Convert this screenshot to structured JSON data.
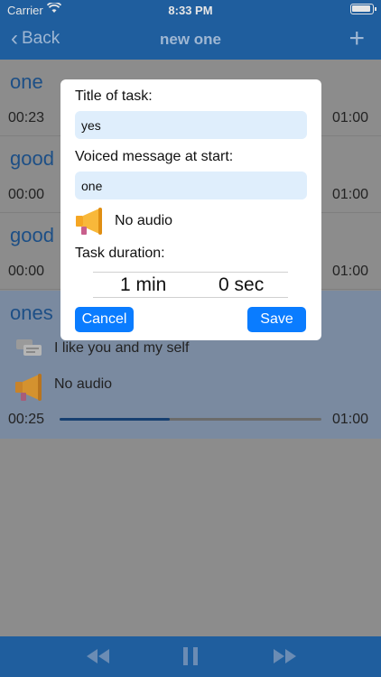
{
  "status_bar": {
    "carrier": "Carrier",
    "time": "8:33 PM"
  },
  "nav": {
    "back_label": "Back",
    "title": "new one",
    "add_icon": "plus-icon"
  },
  "tasks": [
    {
      "name": "one",
      "elapsed": "00:23",
      "duration": "01:00"
    },
    {
      "name": "good",
      "elapsed": "00:00",
      "duration": "01:00"
    },
    {
      "name": "good",
      "elapsed": "00:00",
      "duration": "01:00"
    }
  ],
  "active_task": {
    "name": "ones",
    "message": "I like you and my self",
    "audio": "No audio",
    "elapsed": "00:25",
    "duration": "01:00",
    "progress": 0.42
  },
  "dialog": {
    "title_label": "Title of task:",
    "title_value": "yes",
    "voiced_label": "Voiced message at start:",
    "voiced_value": "one",
    "audio_label": "No audio",
    "duration_label": "Task duration:",
    "minutes": "1 min",
    "seconds": "0 sec",
    "cancel_label": "Cancel",
    "save_label": "Save"
  },
  "toolbar": {
    "icons": [
      "rewind-icon",
      "pause-icon",
      "fast-forward-icon"
    ]
  },
  "colors": {
    "accent": "#0a7cff",
    "bar": "#1f5e9e",
    "field": "#dfeefc",
    "horn": "#f5a623"
  }
}
